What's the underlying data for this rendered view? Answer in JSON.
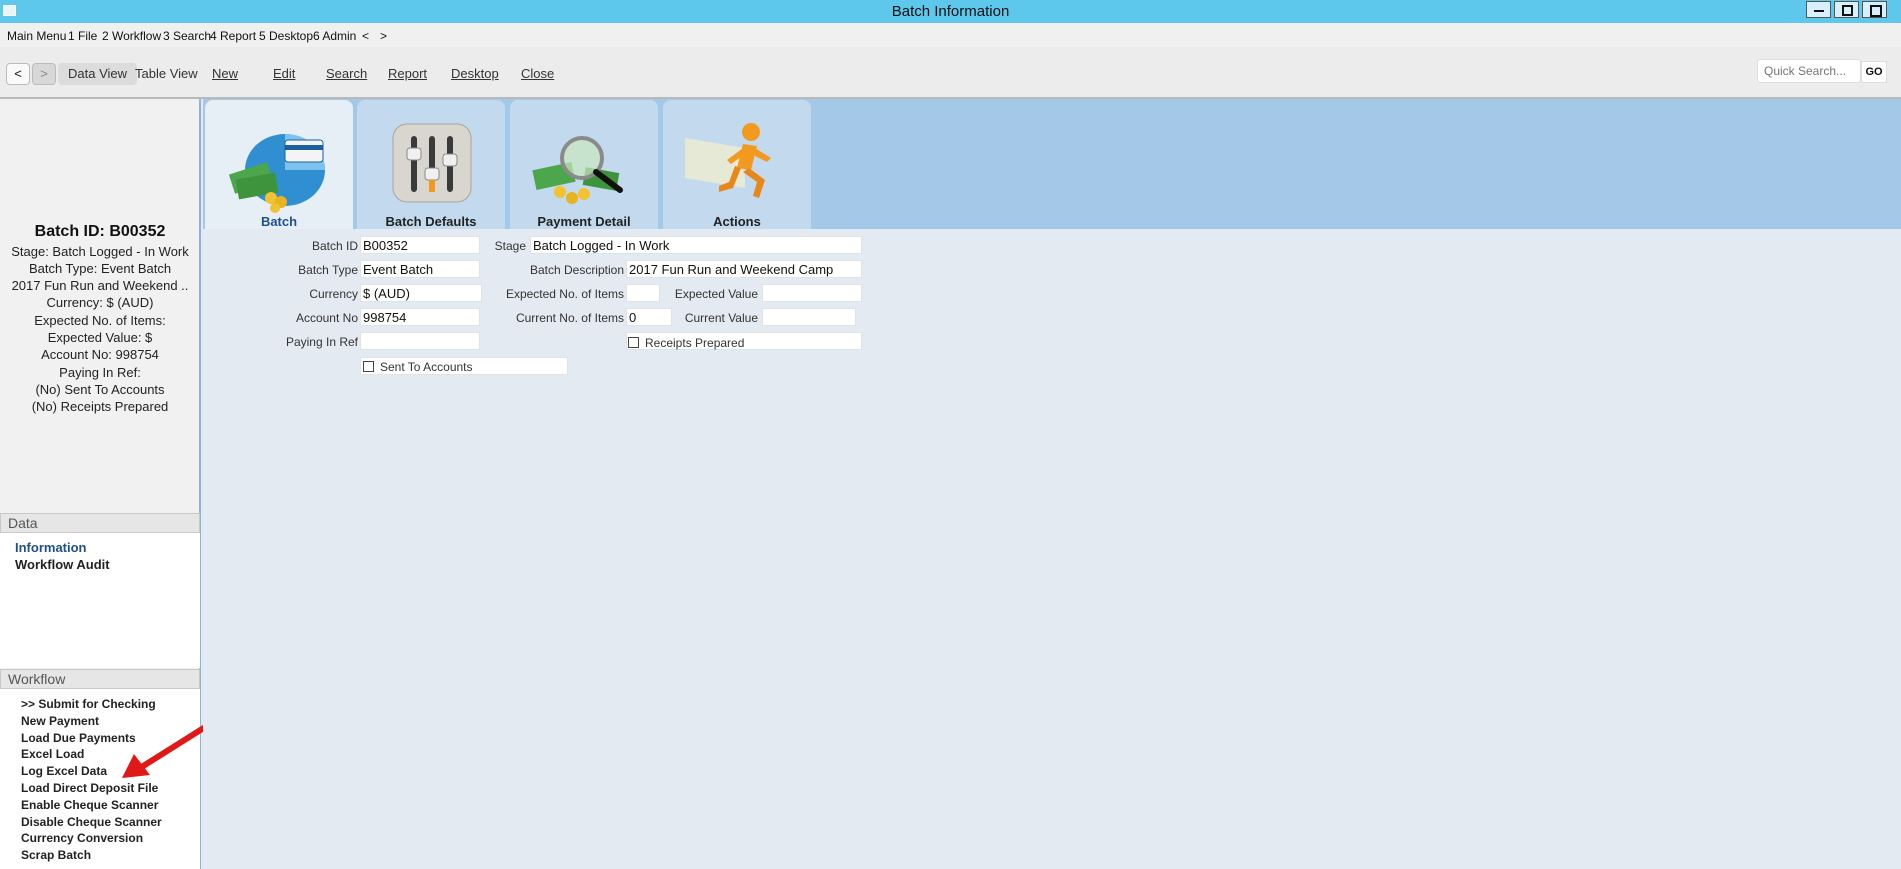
{
  "window": {
    "title": "Batch Information"
  },
  "menu": {
    "items": [
      "Main Menu",
      "1 File",
      "2 Workflow",
      "3 Search",
      "4 Report",
      "5 Desktop",
      "6 Admin",
      "<",
      ">"
    ]
  },
  "toolbar": {
    "back": "<",
    "forward": ">",
    "items": [
      "Data View",
      "Table View",
      "New",
      "Edit",
      "Search",
      "Report",
      "Desktop",
      "Close"
    ],
    "quick_search_placeholder": "Quick Search...",
    "go": "GO"
  },
  "summary": {
    "title": "Batch ID: B00352",
    "lines": [
      "Stage: Batch Logged - In Work",
      "Batch Type: Event Batch",
      "2017 Fun Run and Weekend ..",
      "Currency: $ (AUD)",
      "Expected No. of Items:",
      "Expected Value: $",
      "Account No: 998754",
      "Paying In Ref:",
      "(No) Sent To Accounts",
      "(No) Receipts Prepared"
    ]
  },
  "data_section": {
    "header": "Data",
    "items": [
      "Information",
      "Workflow Audit"
    ]
  },
  "workflow_section": {
    "header": "Workflow",
    "items": [
      ">> Submit for Checking",
      "New Payment",
      "Load Due Payments",
      "Excel Load",
      "Log Excel Data",
      "Load Direct Deposit File",
      "Enable Cheque Scanner",
      "Disable Cheque Scanner",
      "Currency Conversion",
      "Scrap Batch"
    ]
  },
  "tabs": [
    "Batch",
    "Batch Defaults",
    "Payment Detail",
    "Actions"
  ],
  "form": {
    "batch_id": {
      "label": "Batch ID",
      "value": "B00352"
    },
    "stage": {
      "label": "Stage",
      "value": "Batch Logged - In Work"
    },
    "batch_type": {
      "label": "Batch Type",
      "value": "Event Batch"
    },
    "batch_description": {
      "label": "Batch Description",
      "value": "2017 Fun Run and Weekend Camp"
    },
    "currency": {
      "label": "Currency",
      "value": "$ (AUD)"
    },
    "expected_items": {
      "label": "Expected No. of Items",
      "value": ""
    },
    "expected_value": {
      "label": "Expected Value",
      "value": ""
    },
    "account_no": {
      "label": "Account No",
      "value": "998754"
    },
    "current_items": {
      "label": "Current No. of Items",
      "value": "0"
    },
    "current_value": {
      "label": "Current Value",
      "value": ""
    },
    "paying_in_ref": {
      "label": "Paying In Ref",
      "value": ""
    },
    "receipts_prepared": {
      "label": "Receipts Prepared",
      "checked": false
    },
    "sent_to_accounts": {
      "label": "Sent To Accounts",
      "checked": false
    }
  },
  "colors": {
    "titlebar": "#5ec8ec",
    "tab_strip": "#a4c8e8",
    "active_link": "#1f4f8c",
    "arrow": "#e01818"
  },
  "icons": [
    "credit-card-pie-icon",
    "equalizer-sliders-icon",
    "magnifier-money-icon",
    "running-man-icon"
  ]
}
